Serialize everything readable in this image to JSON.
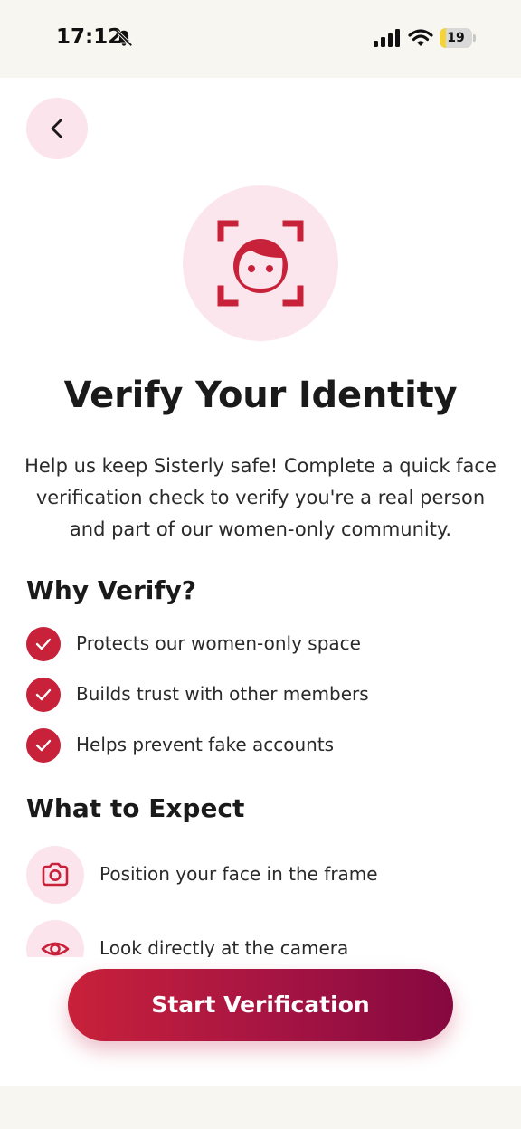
{
  "status_bar": {
    "time": "17:12",
    "battery_level": "19",
    "battery_fraction": 0.19,
    "icons": [
      "bell-off-icon",
      "signal-icon",
      "wifi-icon",
      "battery-icon"
    ]
  },
  "header": {
    "back_icon": "chevron-left-icon"
  },
  "hero": {
    "icon": "face-scan-icon"
  },
  "title": "Verify Your Identity",
  "intro_lines": [
    "Help us keep Sisterly safe! Complete a quick face",
    "verification check to verify you're a real person",
    "and part of our women-only community."
  ],
  "why": {
    "title": "Why Verify?",
    "items": [
      "Protects our women-only space",
      "Builds trust with other members",
      "Helps prevent fake accounts"
    ]
  },
  "expect": {
    "title": "What to Expect",
    "items": [
      {
        "icon": "camera-icon",
        "label": "Position your face in the frame"
      },
      {
        "icon": "eye-icon",
        "label": "Look directly at the camera"
      }
    ]
  },
  "cta": {
    "label": "Start Verification"
  },
  "colors": {
    "accent": "#c8213a",
    "accent_dark": "#85083f",
    "soft_pink": "#fce4ec"
  }
}
